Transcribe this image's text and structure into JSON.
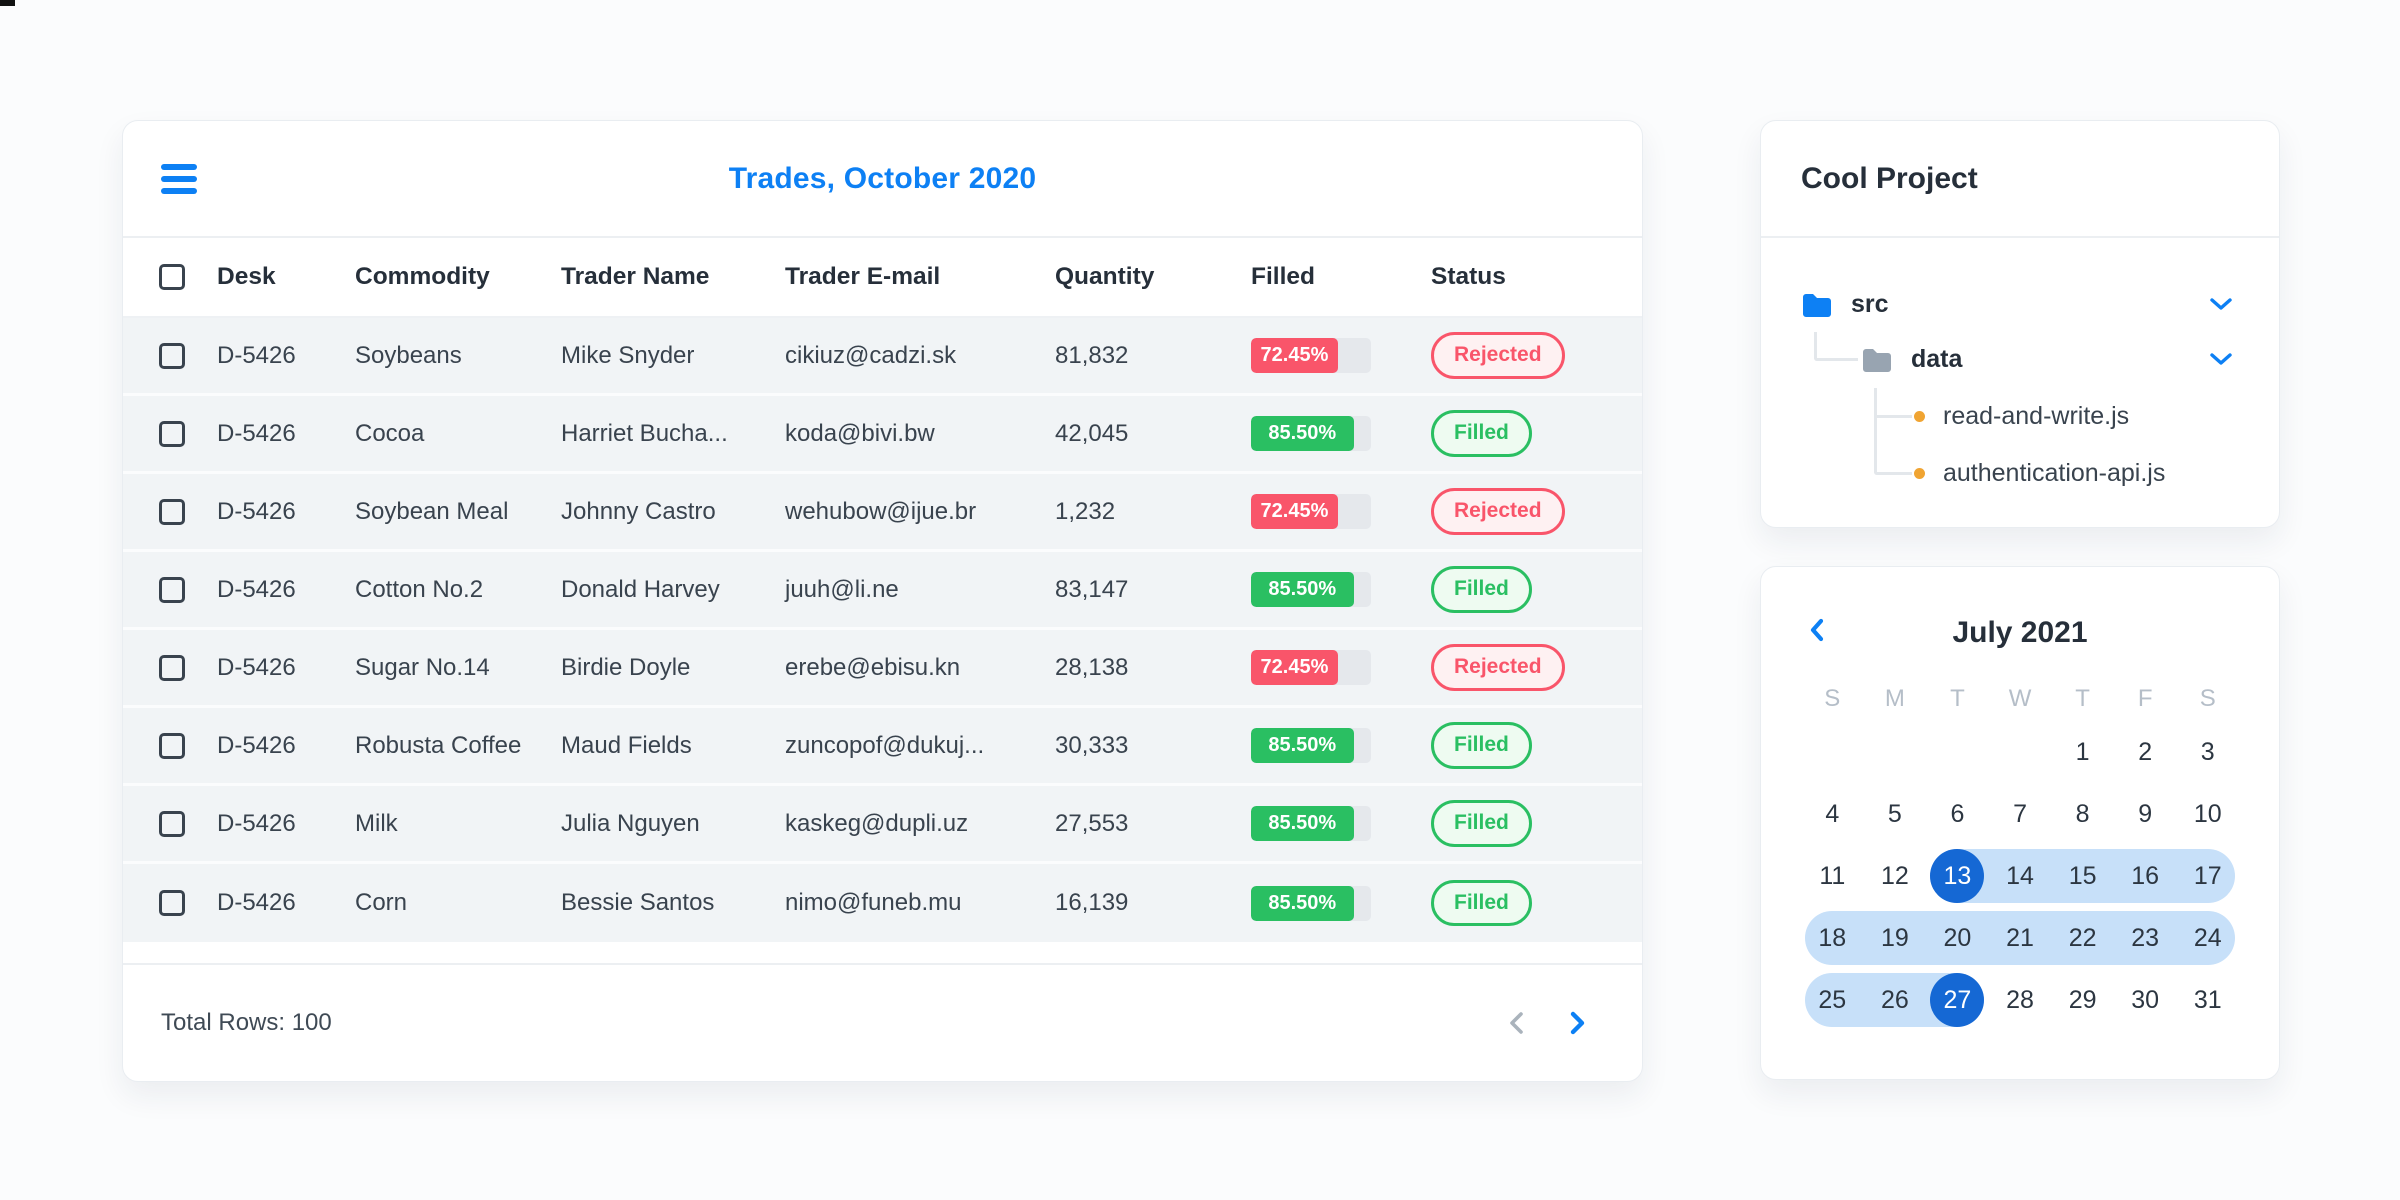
{
  "trades_card": {
    "title": "Trades, October 2020",
    "columns": [
      "Desk",
      "Commodity",
      "Trader Name",
      "Trader E-mail",
      "Quantity",
      "Filled",
      "Status"
    ],
    "rows": [
      {
        "desk": "D-5426",
        "commodity": "Soybeans",
        "trader": "Mike Snyder",
        "email": "cikiuz@cadzi.sk",
        "quantity": "81,832",
        "filled_pct": "72.45%",
        "filled_value": 72.45,
        "status": "Rejected"
      },
      {
        "desk": "D-5426",
        "commodity": "Cocoa",
        "trader": "Harriet Bucha...",
        "email": "koda@bivi.bw",
        "quantity": "42,045",
        "filled_pct": "85.50%",
        "filled_value": 85.5,
        "status": "Filled"
      },
      {
        "desk": "D-5426",
        "commodity": "Soybean Meal",
        "trader": "Johnny Castro",
        "email": "wehubow@ijue.br",
        "quantity": "1,232",
        "filled_pct": "72.45%",
        "filled_value": 72.45,
        "status": "Rejected"
      },
      {
        "desk": "D-5426",
        "commodity": "Cotton No.2",
        "trader": "Donald Harvey",
        "email": "juuh@li.ne",
        "quantity": "83,147",
        "filled_pct": "85.50%",
        "filled_value": 85.5,
        "status": "Filled"
      },
      {
        "desk": "D-5426",
        "commodity": "Sugar No.14",
        "trader": "Birdie Doyle",
        "email": "erebe@ebisu.kn",
        "quantity": "28,138",
        "filled_pct": "72.45%",
        "filled_value": 72.45,
        "status": "Rejected"
      },
      {
        "desk": "D-5426",
        "commodity": "Robusta Coffee",
        "trader": "Maud Fields",
        "email": "zuncopof@dukuj...",
        "quantity": "30,333",
        "filled_pct": "85.50%",
        "filled_value": 85.5,
        "status": "Filled"
      },
      {
        "desk": "D-5426",
        "commodity": "Milk",
        "trader": "Julia Nguyen",
        "email": "kaskeg@dupli.uz",
        "quantity": "27,553",
        "filled_pct": "85.50%",
        "filled_value": 85.5,
        "status": "Filled"
      },
      {
        "desk": "D-5426",
        "commodity": "Corn",
        "trader": "Bessie Santos",
        "email": "nimo@funeb.mu",
        "quantity": "16,139",
        "filled_pct": "85.50%",
        "filled_value": 85.5,
        "status": "Filled"
      }
    ],
    "footer": {
      "total_label": "Total Rows: 100"
    }
  },
  "project_card": {
    "title": "Cool Project",
    "tree": [
      {
        "label": "src",
        "type": "folder",
        "color": "blue",
        "chevron": "down"
      },
      {
        "label": "data",
        "type": "folder",
        "color": "gray",
        "chevron": "down"
      },
      {
        "label": "read-and-write.js",
        "type": "file"
      },
      {
        "label": "authentication-api.js",
        "type": "file"
      }
    ]
  },
  "calendar_card": {
    "title": "July 2021",
    "day_headers": [
      "S",
      "M",
      "T",
      "W",
      "T",
      "F",
      "S"
    ],
    "weeks": [
      [
        "",
        "",
        "",
        "",
        "1",
        "2",
        "3"
      ],
      [
        "4",
        "5",
        "6",
        "7",
        "8",
        "9",
        "10"
      ],
      [
        "11",
        "12",
        "13",
        "14",
        "15",
        "16",
        "17"
      ],
      [
        "18",
        "19",
        "20",
        "21",
        "22",
        "23",
        "24"
      ],
      [
        "25",
        "26",
        "27",
        "28",
        "29",
        "30",
        "31"
      ]
    ],
    "range_start": 13,
    "range_end": 27,
    "selected_days": [
      13,
      27
    ]
  },
  "colors": {
    "accent_blue": "#0d80f4",
    "selected_blue": "#1568d4",
    "range_blue": "#c7e0f9",
    "status_red": "#f9556a",
    "status_green": "#2abf62",
    "file_dot_amber": "#f0a432"
  }
}
